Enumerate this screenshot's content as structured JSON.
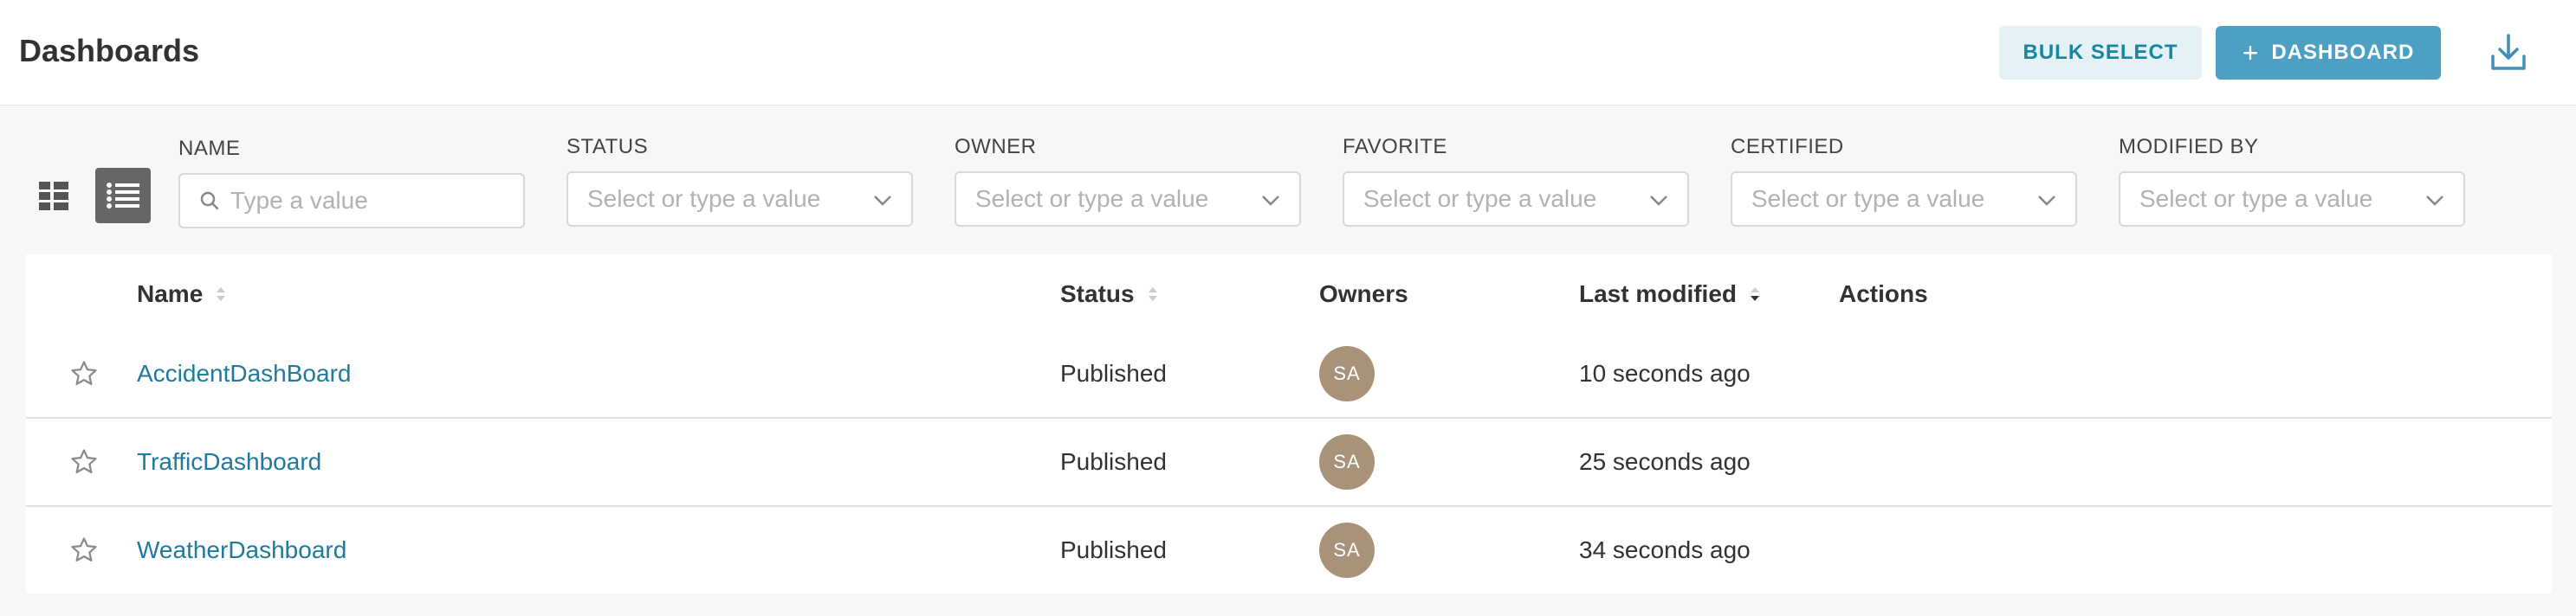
{
  "header": {
    "title": "Dashboards",
    "bulk_select_label": "BULK SELECT",
    "add_dashboard_label": "DASHBOARD",
    "add_dashboard_icon": "plus-icon",
    "download_icon": "download-icon"
  },
  "view_toggles": {
    "card_icon": "card-grid-icon",
    "list_icon": "list-icon",
    "active": "list"
  },
  "filters": {
    "name": {
      "label": "NAME",
      "placeholder": "Type a value",
      "value": ""
    },
    "status": {
      "label": "STATUS",
      "placeholder": "Select or type a value",
      "value": ""
    },
    "owner": {
      "label": "OWNER",
      "placeholder": "Select or type a value",
      "value": ""
    },
    "favorite": {
      "label": "FAVORITE",
      "placeholder": "Select or type a value",
      "value": ""
    },
    "certified": {
      "label": "CERTIFIED",
      "placeholder": "Select or type a value",
      "value": ""
    },
    "modified_by": {
      "label": "MODIFIED BY",
      "placeholder": "Select or type a value",
      "value": ""
    }
  },
  "table": {
    "columns": {
      "name": "Name",
      "status": "Status",
      "owners": "Owners",
      "last_modified": "Last modified",
      "actions": "Actions"
    },
    "sorted_by": "Last modified",
    "rows": [
      {
        "name": "AccidentDashBoard",
        "status": "Published",
        "owner_initials": "SA",
        "last_modified": "10 seconds ago"
      },
      {
        "name": "TrafficDashboard",
        "status": "Published",
        "owner_initials": "SA",
        "last_modified": "25 seconds ago"
      },
      {
        "name": "WeatherDashboard",
        "status": "Published",
        "owner_initials": "SA",
        "last_modified": "34 seconds ago"
      }
    ]
  },
  "colors": {
    "primary": "#4ba0c4",
    "secondary_bg": "#e4f1f5",
    "link": "#1f7a9c",
    "avatar": "#a8937a"
  }
}
